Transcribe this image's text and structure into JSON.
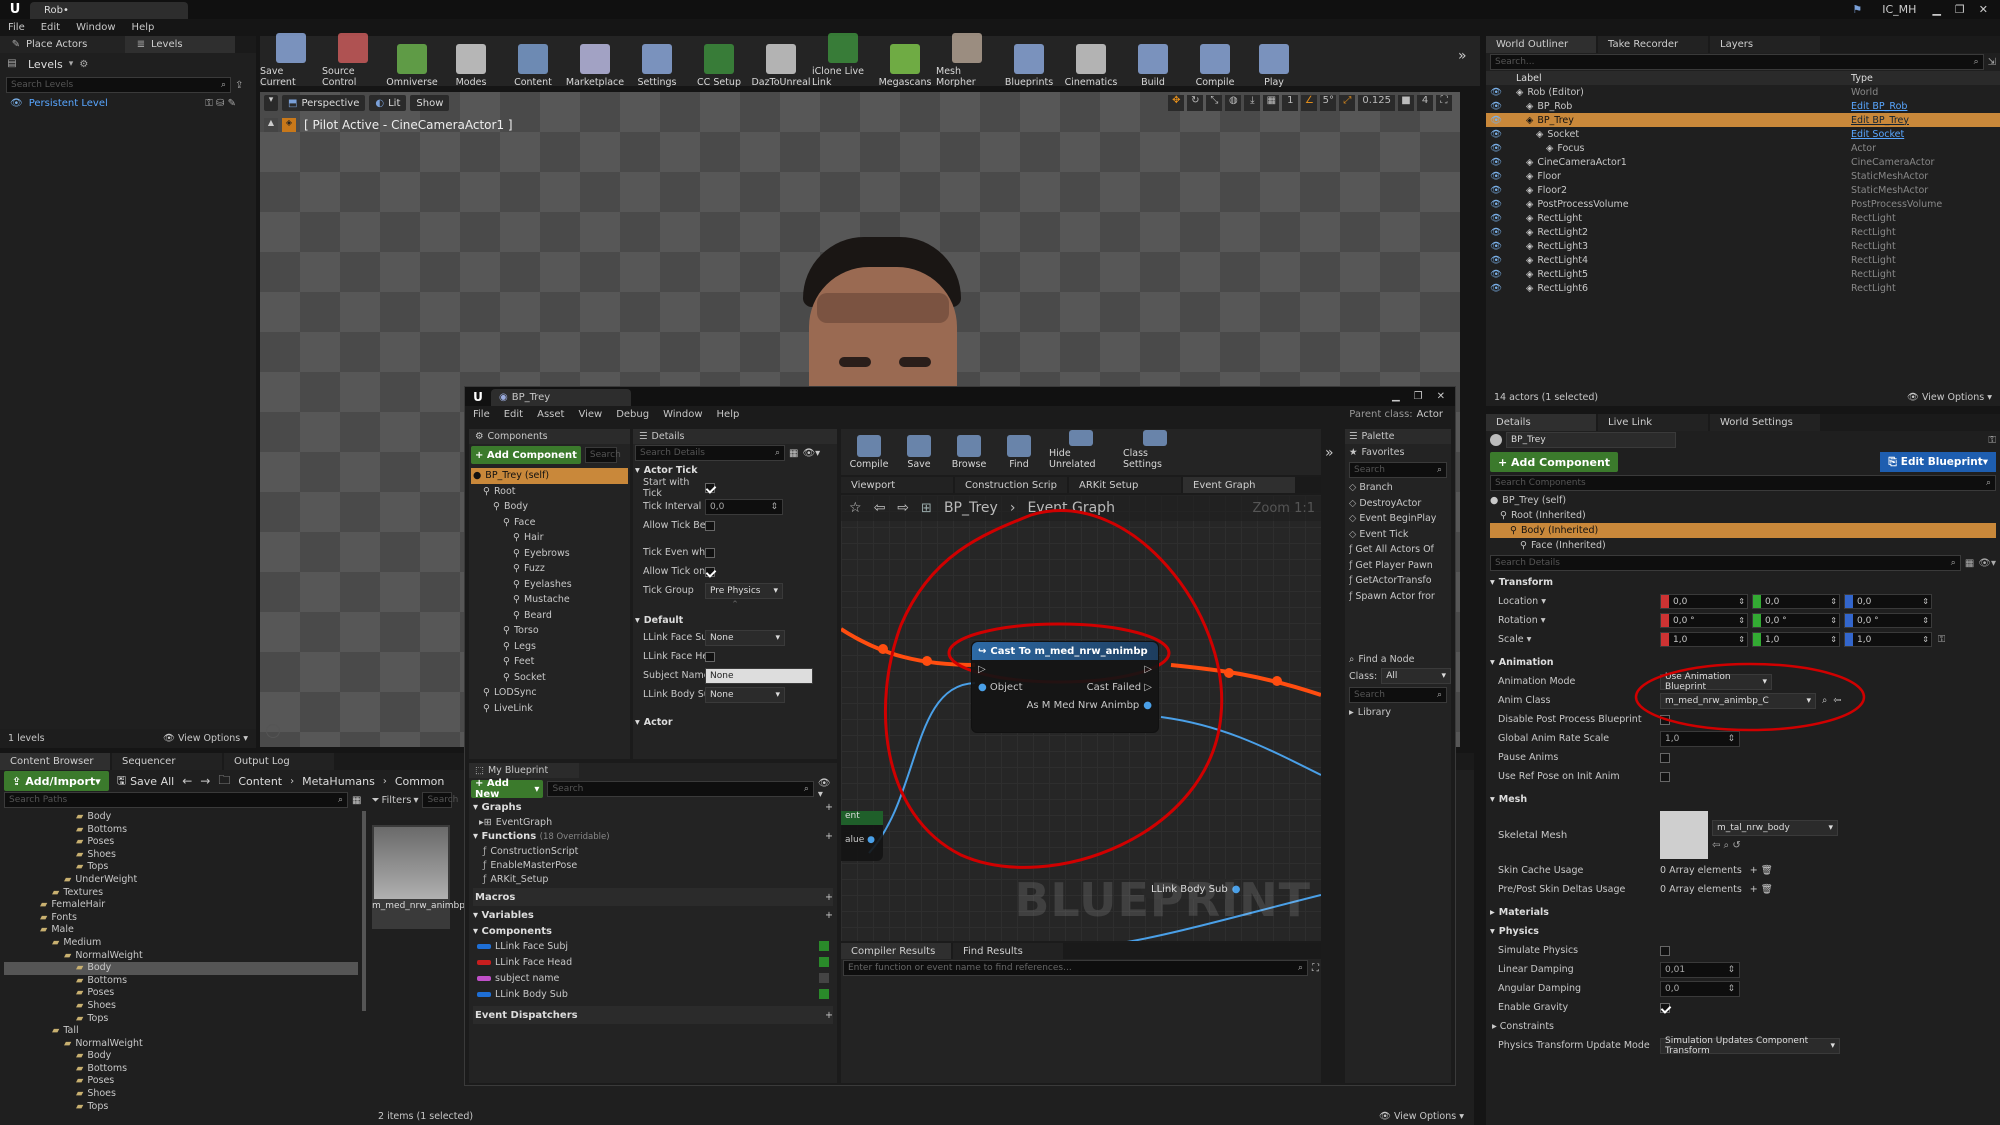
{
  "titlebar": {
    "tab": "Rob•",
    "user_badge": "IC_MH"
  },
  "menu": [
    "File",
    "Edit",
    "Window",
    "Help"
  ],
  "left_top_tabs": {
    "place_actors": "Place Actors",
    "levels": "Levels"
  },
  "levels_panel": {
    "title": "Levels",
    "search_placeholder": "Search Levels",
    "item": "Persistent Level",
    "footer_count": "1 levels",
    "view_options": "View Options"
  },
  "toolbar": [
    {
      "label": "Save Current",
      "icon": "save-icon",
      "color": "#8aa6d8"
    },
    {
      "label": "Source Control",
      "icon": "source-control-icon",
      "color": "#c85b5b"
    },
    {
      "label": "Omniverse",
      "icon": "omniverse-icon",
      "color": "#6ab04c"
    },
    {
      "label": "Modes",
      "icon": "modes-icon",
      "color": "#d0d0d0"
    },
    {
      "label": "Content",
      "icon": "content-icon",
      "color": "#7a9ccc"
    },
    {
      "label": "Marketplace",
      "icon": "marketplace-icon",
      "color": "#b8b8e0"
    },
    {
      "label": "Settings",
      "icon": "settings-icon",
      "color": "#8aa6d8"
    },
    {
      "label": "CC Setup",
      "icon": "cc-setup-icon",
      "color": "#3c8c3c"
    },
    {
      "label": "DazToUnreal",
      "icon": "daz-icon",
      "color": "#cccccc"
    },
    {
      "label": "iClone Live Link",
      "icon": "iclone-icon",
      "color": "#3c8c3c"
    },
    {
      "label": "Megascans",
      "icon": "megascans-icon",
      "color": "#7cc34a"
    },
    {
      "label": "Mesh Morpher",
      "icon": "mesh-morpher-icon",
      "color": "#b0a090"
    },
    {
      "label": "Blueprints",
      "icon": "blueprints-icon",
      "color": "#8aa6d8"
    },
    {
      "label": "Cinematics",
      "icon": "cinematics-icon",
      "color": "#cccccc"
    },
    {
      "label": "Build",
      "icon": "build-icon",
      "color": "#8aa6d8"
    },
    {
      "label": "Compile",
      "icon": "compile-icon",
      "color": "#8aa6d8"
    },
    {
      "label": "Play",
      "icon": "play-icon",
      "color": "#8aa6d8"
    }
  ],
  "viewport": {
    "perspective": "Perspective",
    "lit": "Lit",
    "show": "Show",
    "pilot": "[ Pilot Active - CineCameraActor1 ]",
    "snap_value": "0.125",
    "cam_speed": "4"
  },
  "outliner": {
    "tabs": [
      "World Outliner",
      "Take Recorder",
      "Layers"
    ],
    "search_placeholder": "Search...",
    "col_label": "Label",
    "col_type": "Type",
    "rows": [
      {
        "label": "Rob (Editor)",
        "type": "World",
        "indent": 0,
        "link": false
      },
      {
        "label": "BP_Rob",
        "type": "Edit BP_Rob",
        "indent": 1,
        "link": true
      },
      {
        "label": "BP_Trey",
        "type": "Edit BP_Trey",
        "indent": 1,
        "link": true,
        "selected": true
      },
      {
        "label": "Socket",
        "type": "Edit Socket",
        "indent": 2,
        "link": true
      },
      {
        "label": "Focus",
        "type": "Actor",
        "indent": 3,
        "link": false
      },
      {
        "label": "CineCameraActor1",
        "type": "CineCameraActor",
        "indent": 1,
        "link": false
      },
      {
        "label": "Floor",
        "type": "StaticMeshActor",
        "indent": 1,
        "link": false
      },
      {
        "label": "Floor2",
        "type": "StaticMeshActor",
        "indent": 1,
        "link": false
      },
      {
        "label": "PostProcessVolume",
        "type": "PostProcessVolume",
        "indent": 1,
        "link": false
      },
      {
        "label": "RectLight",
        "type": "RectLight",
        "indent": 1,
        "link": false
      },
      {
        "label": "RectLight2",
        "type": "RectLight",
        "indent": 1,
        "link": false
      },
      {
        "label": "RectLight3",
        "type": "RectLight",
        "indent": 1,
        "link": false
      },
      {
        "label": "RectLight4",
        "type": "RectLight",
        "indent": 1,
        "link": false
      },
      {
        "label": "RectLight5",
        "type": "RectLight",
        "indent": 1,
        "link": false
      },
      {
        "label": "RectLight6",
        "type": "RectLight",
        "indent": 1,
        "link": false
      }
    ],
    "status": "14 actors (1 selected)",
    "view_options": "View Options"
  },
  "details_right": {
    "tabs": [
      "Details",
      "Live Link",
      "World Settings"
    ],
    "name": "BP_Trey",
    "add_component": "+ Add Component",
    "edit_blueprint": "Edit Blueprint",
    "search_components": "Search Components",
    "components": [
      {
        "label": "BP_Trey (self)",
        "indent": 0
      },
      {
        "label": "Root (Inherited)",
        "indent": 1
      },
      {
        "label": "Body (Inherited)",
        "indent": 2,
        "selected": true
      },
      {
        "label": "Face (Inherited)",
        "indent": 3
      }
    ],
    "search_details": "Search Details",
    "transform": {
      "title": "Transform",
      "location": "Location",
      "rotation": "Rotation",
      "scale": "Scale",
      "loc": [
        "0,0",
        "0,0",
        "0,0"
      ],
      "rot": [
        "0,0 °",
        "0,0 °",
        "0,0 °"
      ],
      "scl": [
        "1,0",
        "1,0",
        "1,0"
      ]
    },
    "animation": {
      "title": "Animation",
      "mode_label": "Animation Mode",
      "mode_value": "Use Animation Blueprint",
      "class_label": "Anim Class",
      "class_value": "m_med_nrw_animbp_C",
      "disable_pp": "Disable Post Process Blueprint",
      "rate_label": "Global Anim Rate Scale",
      "rate_value": "1,0",
      "pause": "Pause Anims",
      "ref_pose": "Use Ref Pose on Init Anim"
    },
    "mesh": {
      "title": "Mesh",
      "skeletal_label": "Skeletal Mesh",
      "skeletal_value": "m_tal_nrw_body",
      "skin_cache": "Skin Cache Usage",
      "skin_cache_value": "0 Array elements",
      "pre_post": "Pre/Post Skin Deltas Usage",
      "pre_post_value": "0 Array elements"
    },
    "materials": "Materials",
    "physics": {
      "title": "Physics",
      "simulate": "Simulate Physics",
      "linear": "Linear Damping",
      "linear_value": "0,01",
      "angular": "Angular Damping",
      "angular_value": "0,0",
      "gravity": "Enable Gravity",
      "constraints": "Constraints",
      "update_mode": "Physics Transform Update Mode",
      "update_value": "Simulation Updates Component Transform"
    }
  },
  "content_browser": {
    "tabs": [
      "Content Browser",
      "Sequencer",
      "Output Log"
    ],
    "add_import": "Add/Import",
    "save_all": "Save All",
    "path": [
      "Content",
      "MetaHumans",
      "Common"
    ],
    "search_paths": "Search Paths",
    "filters": "Filters",
    "search": "Search",
    "tree": [
      {
        "label": "Body",
        "indent": 4
      },
      {
        "label": "Bottoms",
        "indent": 4
      },
      {
        "label": "Poses",
        "indent": 4
      },
      {
        "label": "Shoes",
        "indent": 4
      },
      {
        "label": "Tops",
        "indent": 4
      },
      {
        "label": "UnderWeight",
        "indent": 3
      },
      {
        "label": "Textures",
        "indent": 2
      },
      {
        "label": "FemaleHair",
        "indent": 1
      },
      {
        "label": "Fonts",
        "indent": 1
      },
      {
        "label": "Male",
        "indent": 1
      },
      {
        "label": "Medium",
        "indent": 2
      },
      {
        "label": "NormalWeight",
        "indent": 3
      },
      {
        "label": "Body",
        "indent": 4,
        "selected": true
      },
      {
        "label": "Bottoms",
        "indent": 4
      },
      {
        "label": "Poses",
        "indent": 4
      },
      {
        "label": "Shoes",
        "indent": 4
      },
      {
        "label": "Tops",
        "indent": 4
      },
      {
        "label": "Tall",
        "indent": 2
      },
      {
        "label": "NormalWeight",
        "indent": 3
      },
      {
        "label": "Body",
        "indent": 4
      },
      {
        "label": "Bottoms",
        "indent": 4
      },
      {
        "label": "Poses",
        "indent": 4
      },
      {
        "label": "Shoes",
        "indent": 4
      },
      {
        "label": "Tops",
        "indent": 4
      }
    ],
    "asset_name": "m_med_nrw_animbp",
    "status": "2 items (1 selected)",
    "view_options": "View Options"
  },
  "bp_editor": {
    "title_tab": "BP_Trey",
    "menu": [
      "File",
      "Edit",
      "Asset",
      "View",
      "Debug",
      "Window",
      "Help"
    ],
    "parent_class_label": "Parent class:",
    "parent_class": "Actor",
    "components_tab": "Components",
    "add_component": "+ Add Component",
    "search": "Search",
    "comp_tree": [
      {
        "label": "BP_Trey (self)",
        "indent": 0,
        "selected": true
      },
      {
        "label": "Root",
        "indent": 1
      },
      {
        "label": "Body",
        "indent": 2
      },
      {
        "label": "Face",
        "indent": 3
      },
      {
        "label": "Hair",
        "indent": 4
      },
      {
        "label": "Eyebrows",
        "indent": 4
      },
      {
        "label": "Fuzz",
        "indent": 4
      },
      {
        "label": "Eyelashes",
        "indent": 4
      },
      {
        "label": "Mustache",
        "indent": 4
      },
      {
        "label": "Beard",
        "indent": 4
      },
      {
        "label": "Torso",
        "indent": 3
      },
      {
        "label": "Legs",
        "indent": 3
      },
      {
        "label": "Feet",
        "indent": 3
      },
      {
        "label": "Socket",
        "indent": 3
      },
      {
        "label": "LODSync",
        "indent": 1
      },
      {
        "label": "LiveLink",
        "indent": 1
      }
    ],
    "details_tab": "Details",
    "search_details": "Search Details",
    "actor_tick": {
      "title": "Actor Tick",
      "start": "Start with Tick",
      "interval": "Tick Interval (",
      "interval_value": "0,0",
      "allow_before": "Allow Tick Bef",
      "tick_even": "Tick Even whe",
      "allow_on": "Allow Tick on I",
      "group": "Tick Group",
      "group_value": "Pre Physics"
    },
    "default": {
      "title": "Default",
      "face_subj": "LLink Face Su",
      "face_subj_value": "None",
      "face_head": "LLink Face He",
      "subject": "Subject Name",
      "subject_value": "None",
      "body_sub": "LLink Body Su",
      "body_sub_value": "None"
    },
    "actor_section": "Actor",
    "my_blueprint": "My Blueprint",
    "add_new": "+ Add New",
    "graphs": "Graphs",
    "event_graph": "EventGraph",
    "functions": "Functions",
    "functions_count": "(18 Overridable)",
    "function_items": [
      "ConstructionScript",
      "EnableMasterPose",
      "ARKit_Setup"
    ],
    "macros": "Macros",
    "variables": "Variables",
    "components": "Components",
    "var_items": [
      {
        "label": "LLink Face Subj",
        "color": "#1e6fd6"
      },
      {
        "label": "LLink Face Head",
        "color": "#c81e1e"
      },
      {
        "label": "subject name",
        "color": "#c050c8"
      },
      {
        "label": "LLink Body Sub",
        "color": "#1e6fd6"
      }
    ],
    "event_dispatchers": "Event Dispatchers",
    "tools": [
      {
        "label": "Compile"
      },
      {
        "label": "Save"
      },
      {
        "label": "Browse"
      },
      {
        "label": "Find"
      },
      {
        "label": "Hide Unrelated"
      },
      {
        "label": "Class Settings"
      }
    ],
    "graph_tabs": [
      "Viewport",
      "Construction Scrip",
      "ARKit Setup",
      "Event Graph"
    ],
    "breadcrumb": [
      "BP_Trey",
      "Event Graph"
    ],
    "zoom": "Zoom 1:1",
    "node_title": "Cast To m_med_nrw_animbp",
    "node_object": "Object",
    "node_fail": "Cast Failed",
    "node_out": "As M Med Nrw Animbp",
    "left_node_pin": "alue",
    "left_node_label": "ent",
    "var_node": "LLink Body Sub",
    "watermark": "BLUEPRINT",
    "compiler_tabs": [
      "Compiler Results",
      "Find Results"
    ],
    "find_placeholder": "Enter function or event name to find references...",
    "palette": "Palette",
    "favorites": "Favorites",
    "search_palette": "Search",
    "palette_items": [
      "Branch",
      "DestroyActor",
      "Event BeginPlay",
      "Event Tick",
      "Get All Actors Of",
      "Get Player Pawn",
      "GetActorTransfo",
      "Spawn Actor fror"
    ],
    "find_node": "Find a Node",
    "class_label": "Class:",
    "class_value": "All",
    "library": "Library"
  },
  "colors": {
    "accent_orange": "#e08c1a",
    "annotation_red": "#d00000",
    "selection": "#c9883a",
    "link_blue": "#4aa0ff",
    "green_btn": "#3b7a2c"
  }
}
